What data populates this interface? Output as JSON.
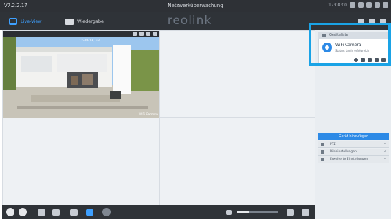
{
  "titlebar": {
    "version": "V7.2.2.17",
    "title": "Netzwerküberwachung",
    "clock": "17:08:00"
  },
  "tabs": [
    {
      "label": "Live-View"
    },
    {
      "label": "Wiedergabe"
    }
  ],
  "brand": "reolink",
  "camera": {
    "osd_time": "12-48-13, Tue",
    "name": "WiFi Camera"
  },
  "sidebar": {
    "devices_header": "Geräteliste",
    "device": {
      "name": "WiFi Camera",
      "status": "Status: Login erfolgreich"
    },
    "add_button": "Gerät hinzufügen",
    "sections": [
      {
        "label": "PTZ"
      },
      {
        "label": "Bildeinstellungen"
      },
      {
        "label": "Erweiterte Einstellungen"
      }
    ]
  },
  "volume": {
    "level": 0.3
  },
  "colors": {
    "accent": "#3ea0ff",
    "highlight": "#1aa3e6",
    "toolbar": "#2f3338"
  },
  "icons": [
    "play-icon",
    "stop-icon",
    "snapshot-icon",
    "record-icon",
    "layout-icon",
    "active-layout-icon",
    "talk-icon",
    "volume-icon",
    "fullscreen-icon"
  ]
}
